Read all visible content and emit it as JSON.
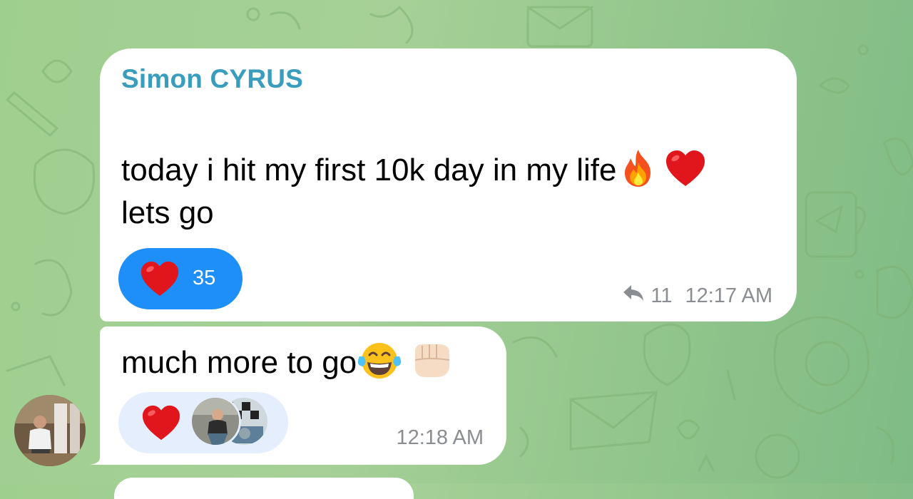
{
  "colors": {
    "background": "#a6d097",
    "bubble": "#ffffff",
    "sender_name": "#3a9dbd",
    "reaction_active": "#1e8ef8",
    "reaction_inactive": "#e4eefc",
    "meta": "#8a8d92"
  },
  "messages": [
    {
      "sender": "Simon CYRUS",
      "line1": "today i hit my first 10k day in my life",
      "line1_emojis": [
        "fire-emoji",
        "red-heart-emoji"
      ],
      "line2": "lets go",
      "reaction": {
        "icon": "red-heart-emoji",
        "count": "35"
      },
      "forward_icon": "reply-arrow-icon",
      "forwards": "11",
      "time": "12:17 AM"
    },
    {
      "text": "much more to go",
      "emojis": [
        "tears-of-joy-emoji",
        "fist-emoji"
      ],
      "reaction": {
        "icon": "red-heart-emoji",
        "reactor_avatars": [
          "reactor-avatar-1",
          "reactor-avatar-2"
        ]
      },
      "time": "12:18 AM"
    }
  ],
  "sender_avatar": "sender-avatar"
}
